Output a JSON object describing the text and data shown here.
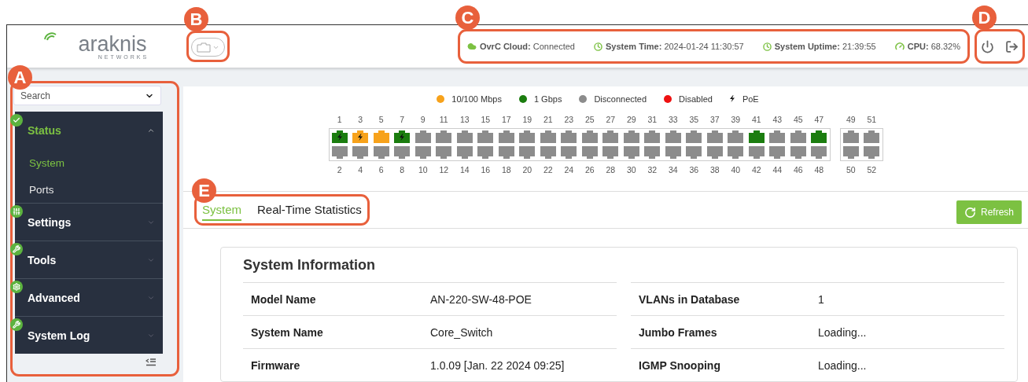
{
  "header": {
    "logo": {
      "wordmark": "araknis",
      "tagline": "NETWORKS"
    },
    "device_selector": {
      "callout": "B"
    },
    "status": {
      "callout": "C",
      "items": [
        {
          "kind": "cloud",
          "label": "OvrC Cloud:",
          "value": "Connected"
        },
        {
          "kind": "clock",
          "label": "System Time:",
          "value": "2024-01-24 11:30:57"
        },
        {
          "kind": "clock",
          "label": "System Uptime:",
          "value": "21:39:55"
        },
        {
          "kind": "gauge",
          "label": "CPU:",
          "value": "68.32%"
        }
      ]
    },
    "actions": {
      "callout": "D",
      "items": [
        {
          "kind": "power"
        },
        {
          "kind": "logout"
        }
      ]
    }
  },
  "sidebar": {
    "callout": "A",
    "search": {
      "placeholder": "Search"
    },
    "items": [
      {
        "kind": "check",
        "label": "Status",
        "expanded": true,
        "children": [
          {
            "label": "System",
            "selected": true
          },
          {
            "label": "Ports",
            "selected": false
          }
        ]
      },
      {
        "kind": "sliders",
        "label": "Settings",
        "expanded": false
      },
      {
        "kind": "wrench",
        "label": "Tools",
        "expanded": false
      },
      {
        "kind": "gear",
        "label": "Advanced",
        "expanded": false
      },
      {
        "kind": "wrench",
        "label": "System Log",
        "expanded": false
      }
    ]
  },
  "legend": [
    {
      "kind": "dot",
      "label": "10/100 Mbps",
      "color": "#f7a21b"
    },
    {
      "kind": "dot",
      "label": "1 Gbps",
      "color": "#1b7d0f"
    },
    {
      "kind": "dot",
      "label": "Disconnected",
      "color": "#8c8c8c"
    },
    {
      "kind": "dot",
      "label": "Disabled",
      "color": "#ee1111"
    },
    {
      "kind": "poe",
      "label": "PoE"
    }
  ],
  "port_groups": [
    {
      "columns": [
        {
          "top": {
            "number": "1",
            "color": "#1b7d0f",
            "poe": true
          },
          "bottom": {
            "number": "2",
            "color": "#8c8c8c",
            "poe": false
          }
        },
        {
          "top": {
            "number": "3",
            "color": "#f7a21b",
            "poe": true
          },
          "bottom": {
            "number": "4",
            "color": "#8c8c8c",
            "poe": false
          }
        },
        {
          "top": {
            "number": "5",
            "color": "#f7a21b",
            "poe": false
          },
          "bottom": {
            "number": "6",
            "color": "#8c8c8c",
            "poe": false
          }
        },
        {
          "top": {
            "number": "7",
            "color": "#1b7d0f",
            "poe": true
          },
          "bottom": {
            "number": "8",
            "color": "#8c8c8c",
            "poe": false
          }
        },
        {
          "top": {
            "number": "9",
            "color": "#8c8c8c",
            "poe": false
          },
          "bottom": {
            "number": "10",
            "color": "#8c8c8c",
            "poe": false
          }
        },
        {
          "top": {
            "number": "11",
            "color": "#8c8c8c",
            "poe": false
          },
          "bottom": {
            "number": "12",
            "color": "#8c8c8c",
            "poe": false
          }
        },
        {
          "top": {
            "number": "13",
            "color": "#8c8c8c",
            "poe": false
          },
          "bottom": {
            "number": "14",
            "color": "#8c8c8c",
            "poe": false
          }
        },
        {
          "top": {
            "number": "15",
            "color": "#8c8c8c",
            "poe": false
          },
          "bottom": {
            "number": "16",
            "color": "#8c8c8c",
            "poe": false
          }
        },
        {
          "top": {
            "number": "17",
            "color": "#8c8c8c",
            "poe": false
          },
          "bottom": {
            "number": "18",
            "color": "#8c8c8c",
            "poe": false
          }
        },
        {
          "top": {
            "number": "19",
            "color": "#8c8c8c",
            "poe": false
          },
          "bottom": {
            "number": "20",
            "color": "#8c8c8c",
            "poe": false
          }
        },
        {
          "top": {
            "number": "21",
            "color": "#8c8c8c",
            "poe": false
          },
          "bottom": {
            "number": "22",
            "color": "#8c8c8c",
            "poe": false
          }
        },
        {
          "top": {
            "number": "23",
            "color": "#8c8c8c",
            "poe": false
          },
          "bottom": {
            "number": "24",
            "color": "#8c8c8c",
            "poe": false
          }
        },
        {
          "top": {
            "number": "25",
            "color": "#8c8c8c",
            "poe": false
          },
          "bottom": {
            "number": "26",
            "color": "#8c8c8c",
            "poe": false
          }
        },
        {
          "top": {
            "number": "27",
            "color": "#8c8c8c",
            "poe": false
          },
          "bottom": {
            "number": "28",
            "color": "#8c8c8c",
            "poe": false
          }
        },
        {
          "top": {
            "number": "29",
            "color": "#8c8c8c",
            "poe": false
          },
          "bottom": {
            "number": "30",
            "color": "#8c8c8c",
            "poe": false
          }
        },
        {
          "top": {
            "number": "31",
            "color": "#8c8c8c",
            "poe": false
          },
          "bottom": {
            "number": "32",
            "color": "#8c8c8c",
            "poe": false
          }
        },
        {
          "top": {
            "number": "33",
            "color": "#8c8c8c",
            "poe": false
          },
          "bottom": {
            "number": "34",
            "color": "#8c8c8c",
            "poe": false
          }
        },
        {
          "top": {
            "number": "35",
            "color": "#8c8c8c",
            "poe": false
          },
          "bottom": {
            "number": "36",
            "color": "#8c8c8c",
            "poe": false
          }
        },
        {
          "top": {
            "number": "37",
            "color": "#8c8c8c",
            "poe": false
          },
          "bottom": {
            "number": "38",
            "color": "#8c8c8c",
            "poe": false
          }
        },
        {
          "top": {
            "number": "39",
            "color": "#8c8c8c",
            "poe": false
          },
          "bottom": {
            "number": "40",
            "color": "#8c8c8c",
            "poe": false
          }
        },
        {
          "top": {
            "number": "41",
            "color": "#1b7d0f",
            "poe": false
          },
          "bottom": {
            "number": "42",
            "color": "#8c8c8c",
            "poe": false
          }
        },
        {
          "top": {
            "number": "43",
            "color": "#8c8c8c",
            "poe": false
          },
          "bottom": {
            "number": "44",
            "color": "#8c8c8c",
            "poe": false
          }
        },
        {
          "top": {
            "number": "45",
            "color": "#8c8c8c",
            "poe": false
          },
          "bottom": {
            "number": "46",
            "color": "#8c8c8c",
            "poe": false
          }
        },
        {
          "top": {
            "number": "47",
            "color": "#1b7d0f",
            "poe": false
          },
          "bottom": {
            "number": "48",
            "color": "#8c8c8c",
            "poe": false
          }
        }
      ]
    },
    {
      "columns": [
        {
          "top": {
            "number": "49",
            "color": "#8c8c8c",
            "poe": false
          },
          "bottom": {
            "number": "50",
            "color": "#8c8c8c",
            "poe": false
          }
        },
        {
          "top": {
            "number": "51",
            "color": "#8c8c8c",
            "poe": false
          },
          "bottom": {
            "number": "52",
            "color": "#8c8c8c",
            "poe": false
          }
        }
      ]
    }
  ],
  "tabs": {
    "callout": "E",
    "items": [
      {
        "label": "System",
        "selected": true
      },
      {
        "label": "Real-Time Statistics",
        "selected": false
      }
    ]
  },
  "refresh_button": {
    "label": "Refresh"
  },
  "system_information": {
    "title": "System Information",
    "rows": [
      {
        "left": {
          "label": "Model Name",
          "value": "AN-220-SW-48-POE"
        },
        "right": {
          "label": "VLANs in Database",
          "value": "1"
        }
      },
      {
        "left": {
          "label": "System Name",
          "value": "Core_Switch"
        },
        "right": {
          "label": "Jumbo Frames",
          "value": "Loading..."
        }
      },
      {
        "left": {
          "label": "Firmware",
          "value": "1.0.09 [Jan. 22 2024 09:25]"
        },
        "right": {
          "label": "IGMP Snooping",
          "value": "Loading..."
        }
      }
    ]
  }
}
